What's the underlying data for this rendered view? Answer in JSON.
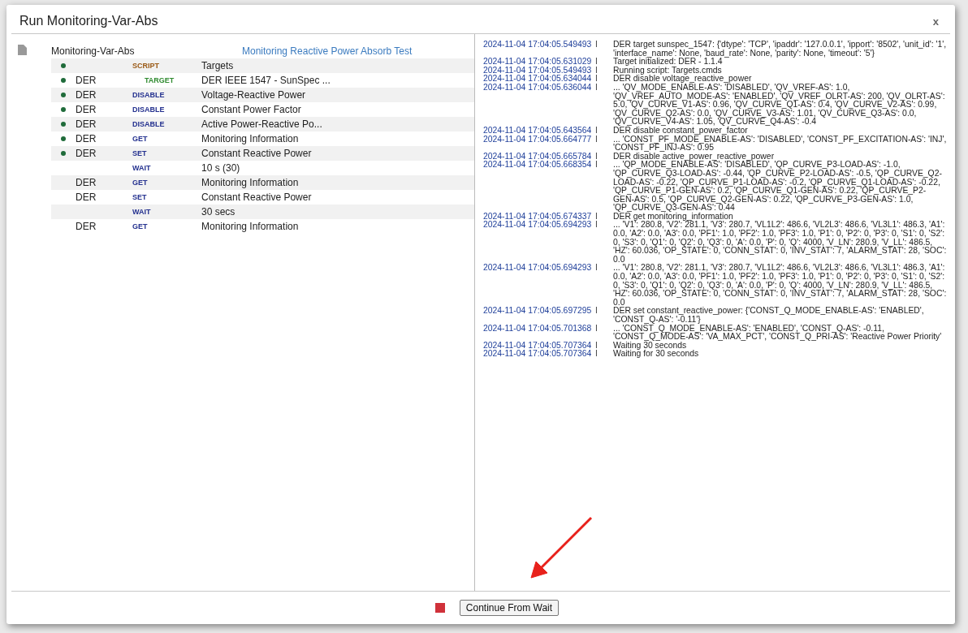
{
  "dialog": {
    "title": "Run Monitoring-Var-Abs",
    "close": "x"
  },
  "suite": {
    "name": "Monitoring-Var-Abs",
    "description": "Monitoring Reactive Power Absorb Test"
  },
  "steps": [
    {
      "done": true,
      "kind": "script",
      "command": "SCRIPT",
      "text": "Targets"
    },
    {
      "done": true,
      "target": "DER",
      "kind": "target",
      "command": "TARGET",
      "text": "DER IEEE 1547 - SunSpec ..."
    },
    {
      "done": true,
      "target": "DER",
      "kind": "disable",
      "command": "DISABLE",
      "text": "Voltage-Reactive Power"
    },
    {
      "done": true,
      "target": "DER",
      "kind": "disable",
      "command": "DISABLE",
      "text": "Constant Power Factor"
    },
    {
      "done": true,
      "target": "DER",
      "kind": "disable",
      "command": "DISABLE",
      "text": "Active Power-Reactive Po..."
    },
    {
      "done": true,
      "target": "DER",
      "kind": "get",
      "command": "GET",
      "text": "Monitoring Information"
    },
    {
      "done": true,
      "target": "DER",
      "kind": "set",
      "command": "SET",
      "text": "Constant Reactive Power"
    },
    {
      "done": false,
      "kind": "wait",
      "command": "WAIT",
      "text": "10 s (30)"
    },
    {
      "done": false,
      "target": "DER",
      "kind": "get",
      "command": "GET",
      "text": "Monitoring Information"
    },
    {
      "done": false,
      "target": "DER",
      "kind": "set",
      "command": "SET",
      "text": "Constant Reactive Power"
    },
    {
      "done": false,
      "kind": "wait",
      "command": "WAIT",
      "text": "30 secs"
    },
    {
      "done": false,
      "target": "DER",
      "kind": "get",
      "command": "GET",
      "text": "Monitoring Information"
    }
  ],
  "log": [
    {
      "time": "2024-11-04 17:04:05.549493",
      "separator": "I",
      "message": "DER target sunspec_1547: {'dtype': 'TCP', 'ipaddr': '127.0.0.1', 'ipport': '8502', 'unit_id': '1', 'interface_name': None, 'baud_rate': None, 'parity': None, 'timeout': '5'}"
    },
    {
      "time": "2024-11-04 17:04:05.631029",
      "separator": "I",
      "message": "Target initialized: DER - 1.1.4"
    },
    {
      "time": "2024-11-04 17:04:05.549493",
      "separator": "I",
      "message": "Running script: Targets.cmds"
    },
    {
      "time": "2024-11-04 17:04:05.634044",
      "separator": "I",
      "message": "DER disable voltage_reactive_power"
    },
    {
      "time": "2024-11-04 17:04:05.636044",
      "separator": "I",
      "message": "... 'QV_MODE_ENABLE-AS': 'DISABLED', 'QV_VREF-AS': 1.0, 'QV_VREF_AUTO_MODE-AS': 'ENABLED', 'QV_VREF_OLRT-AS': 200, 'QV_OLRT-AS': 5.0, 'QV_CURVE_V1-AS': 0.96, 'QV_CURVE_Q1-AS': 0.4, 'QV_CURVE_V2-AS': 0.99, 'QV_CURVE_Q2-AS': 0.0, 'QV_CURVE_V3-AS': 1.01, 'QV_CURVE_Q3-AS': 0.0, 'QV_CURVE_V4-AS': 1.05, 'QV_CURVE_Q4-AS': -0.4"
    },
    {
      "time": "2024-11-04 17:04:05.643564",
      "separator": "I",
      "message": "DER disable constant_power_factor"
    },
    {
      "time": "2024-11-04 17:04:05.664777",
      "separator": "I",
      "message": "... 'CONST_PF_MODE_ENABLE-AS': 'DISABLED', 'CONST_PF_EXCITATION-AS': 'INJ', 'CONST_PF_INJ-AS': 0.95"
    },
    {
      "time": "2024-11-04 17:04:05.665784",
      "separator": "I",
      "message": "DER disable active_power_reactive_power"
    },
    {
      "time": "2024-11-04 17:04:05.668354",
      "separator": "I",
      "message": "... 'QP_MODE_ENABLE-AS': 'DISABLED', 'QP_CURVE_P3-LOAD-AS': -1.0, 'QP_CURVE_Q3-LOAD-AS': -0.44, 'QP_CURVE_P2-LOAD-AS': -0.5, 'QP_CURVE_Q2-LOAD-AS': -0.22, 'QP_CURVE_P1-LOAD-AS': -0.2, 'QP_CURVE_Q1-LOAD-AS': -0.22, 'QP_CURVE_P1-GEN-AS': 0.2, 'QP_CURVE_Q1-GEN-AS': 0.22, 'QP_CURVE_P2-GEN-AS': 0.5, 'QP_CURVE_Q2-GEN-AS': 0.22, 'QP_CURVE_P3-GEN-AS': 1.0, 'QP_CURVE_Q3-GEN-AS': 0.44"
    },
    {
      "time": "2024-11-04 17:04:05.674337",
      "separator": "I",
      "message": "DER get monitoring_information"
    },
    {
      "time": "2024-11-04 17:04:05.694293",
      "separator": "I",
      "message": "... 'V1': 280.8, 'V2': 281.1, 'V3': 280.7, 'VL1L2': 486.6, 'VL2L3': 486.6, 'VL3L1': 486.3, 'A1': 0.0, 'A2': 0.0, 'A3': 0.0, 'PF1': 1.0, 'PF2': 1.0, 'PF3': 1.0, 'P1': 0, 'P2': 0, 'P3': 0, 'S1': 0, 'S2': 0, 'S3': 0, 'Q1': 0, 'Q2': 0, 'Q3': 0, 'A': 0.0, 'P': 0, 'Q': 4000, 'V_LN': 280.9, 'V_LL': 486.5, 'HZ': 60.036, 'OP_STATE': 0, 'CONN_STAT': 0, 'INV_STAT': 7, 'ALARM_STAT': 28, 'SOC': 0.0"
    },
    {
      "time": "2024-11-04 17:04:05.694293",
      "separator": "I",
      "message": "... 'V1': 280.8, 'V2': 281.1, 'V3': 280.7, 'VL1L2': 486.6, 'VL2L3': 486.6, 'VL3L1': 486.3, 'A1': 0.0, 'A2': 0.0, 'A3': 0.0, 'PF1': 1.0, 'PF2': 1.0, 'PF3': 1.0, 'P1': 0, 'P2': 0, 'P3': 0, 'S1': 0, 'S2': 0, 'S3': 0, 'Q1': 0, 'Q2': 0, 'Q3': 0, 'A': 0.0, 'P': 0, 'Q': 4000, 'V_LN': 280.9, 'V_LL': 486.5, 'HZ': 60.036, 'OP_STATE': 0, 'CONN_STAT': 0, 'INV_STAT': 7, 'ALARM_STAT': 28, 'SOC': 0.0"
    },
    {
      "time": "2024-11-04 17:04:05.697295",
      "separator": "I",
      "message": "DER set constant_reactive_power: {'CONST_Q_MODE_ENABLE-AS': 'ENABLED', 'CONST_Q-AS': '-0.11'}"
    },
    {
      "time": "2024-11-04 17:04:05.701368",
      "separator": "I",
      "message": "... 'CONST_Q_MODE_ENABLE-AS': 'ENABLED', 'CONST_Q-AS': -0.11, 'CONST_Q_MODE-AS': 'VA_MAX_PCT', 'CONST_Q_PRI-AS': 'Reactive Power Priority'"
    },
    {
      "time": "2024-11-04 17:04:05.707364",
      "separator": "I",
      "message": "Waiting 30 seconds"
    },
    {
      "time": "2024-11-04 17:04:05.707364",
      "separator": "I",
      "message": "Waiting for 30 seconds"
    }
  ],
  "footer": {
    "stop": true,
    "button": "Continue From Wait"
  }
}
